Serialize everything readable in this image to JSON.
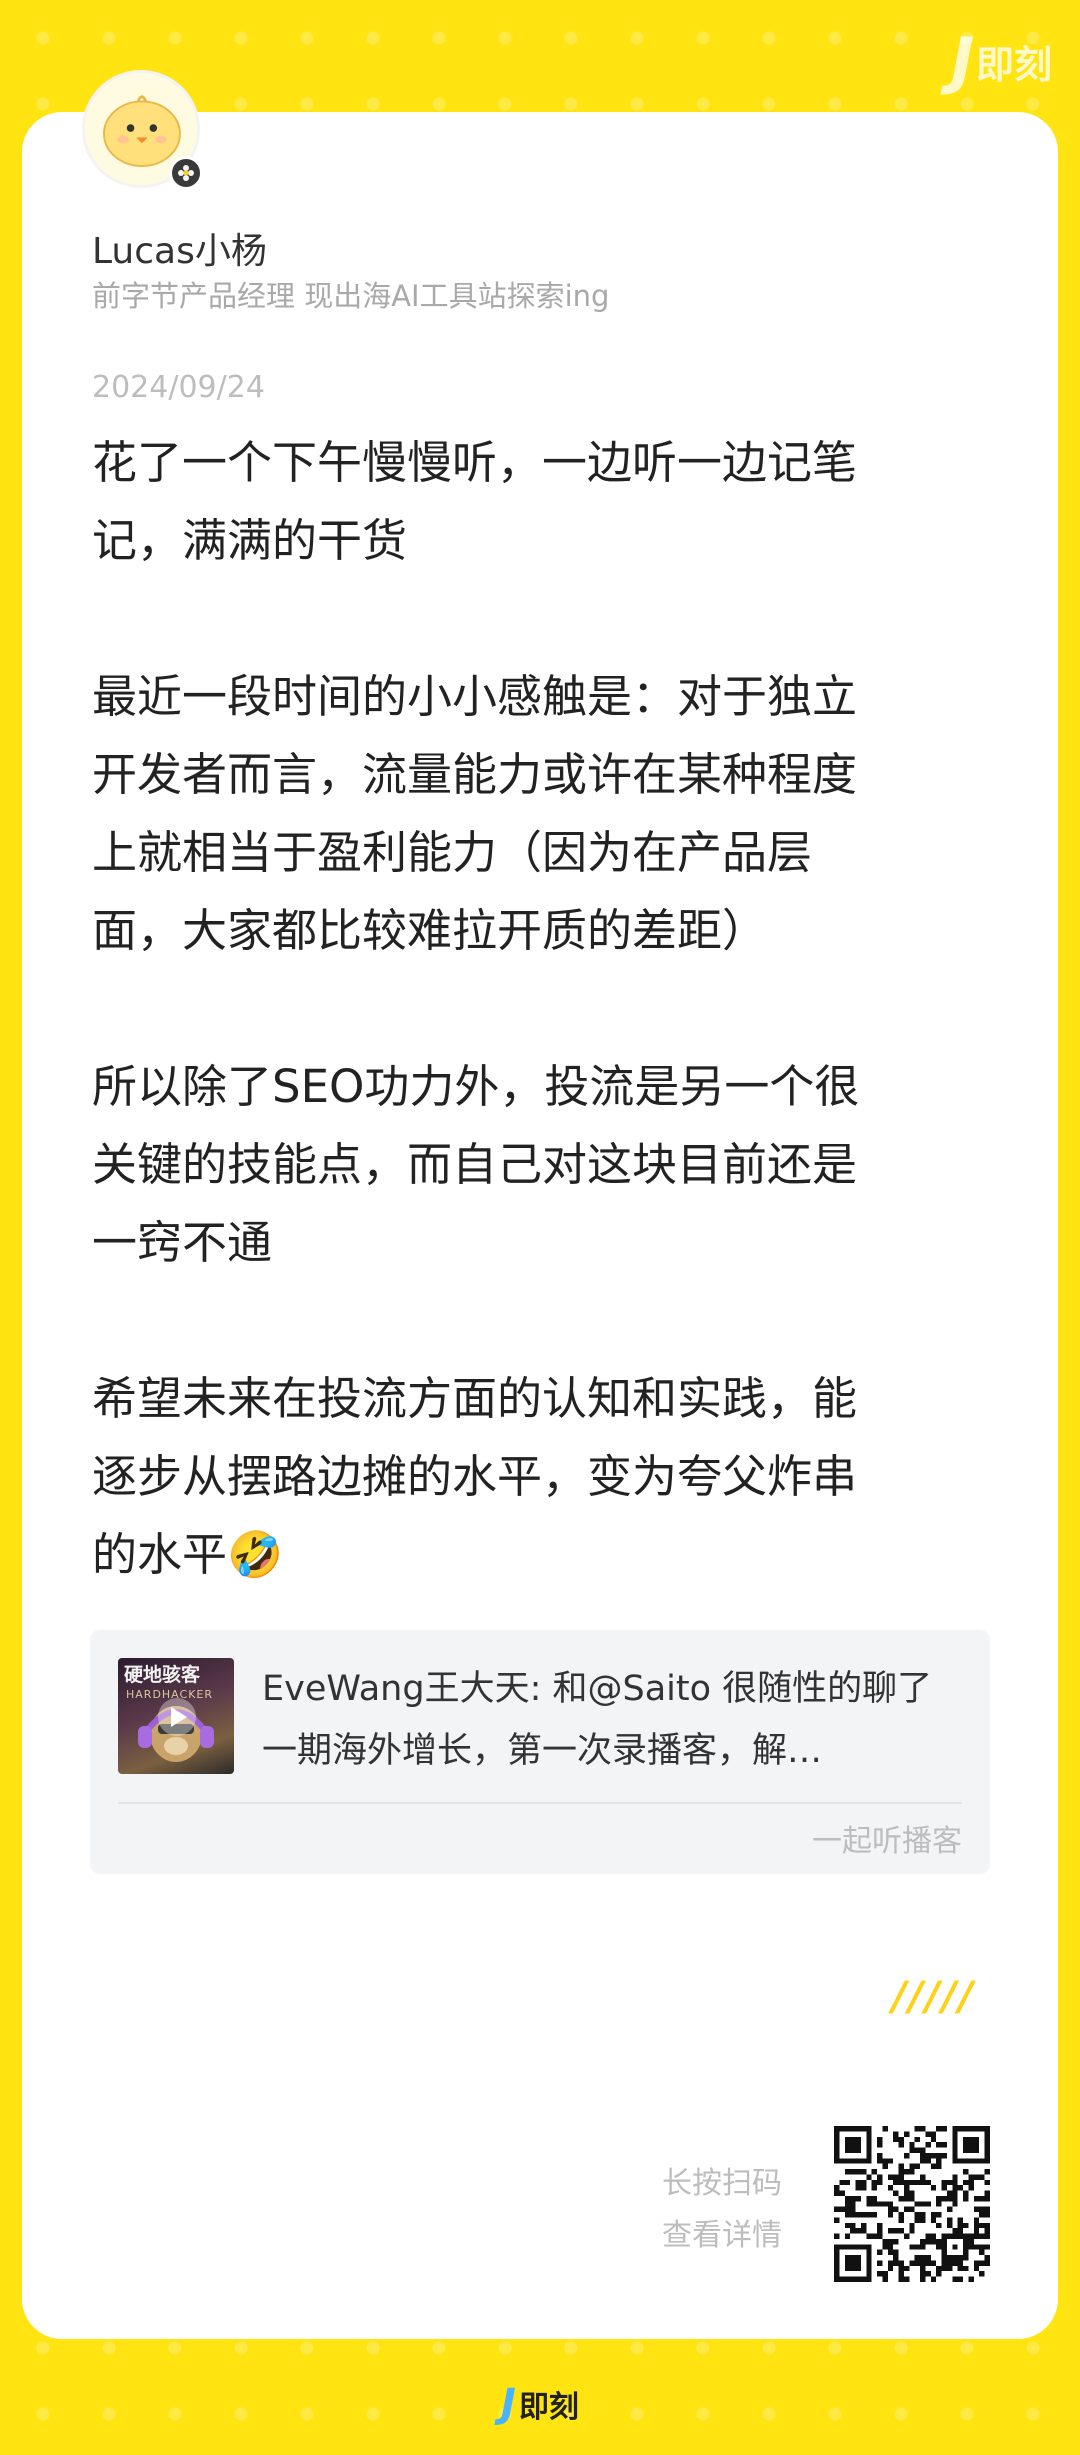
{
  "brand": {
    "logo_mark": "J",
    "name": "即刻"
  },
  "author": {
    "name": "Lucas小杨",
    "bio": "前字节产品经理 现出海AI工具站探索ing",
    "avatar_icon": "yellow-chick-avatar",
    "badge_icon": "flower-badge-icon"
  },
  "post": {
    "date": "2024/09/24",
    "lines": [
      "花了一个下午慢慢听，一边听一边记笔",
      "记，满满的干货",
      "",
      "最近一段时间的小小感触是：对于独立",
      "开发者而言，流量能力或许在某种程度",
      "上就相当于盈利能力（因为在产品层",
      "面，大家都比较难拉开质的差距）",
      "",
      "所以除了SEO功力外，投流是另一个很",
      "关键的技能点，而自己对这块目前还是",
      "一窍不通",
      "",
      "希望未来在投流方面的认知和实践，能",
      "逐步从摆路边摊的水平，变为夸父炸串",
      "的水平🤣"
    ]
  },
  "podcast": {
    "cover_title": "硬地骇客",
    "cover_subtitle": "HARDHACKER",
    "text": "EveWang王大天: 和@Saito 很随性的聊了一期海外增长，第一次录播客，解…",
    "link_label": "一起听播客",
    "play_icon": "play-icon"
  },
  "footer": {
    "decoration": "/////",
    "qr_hint_line1": "长按扫码",
    "qr_hint_line2": "查看详情"
  },
  "colors": {
    "background": "#ffe411",
    "card": "#ffffff",
    "muted_text": "#a9a9a9",
    "brand_blue": "#49b3ff"
  }
}
